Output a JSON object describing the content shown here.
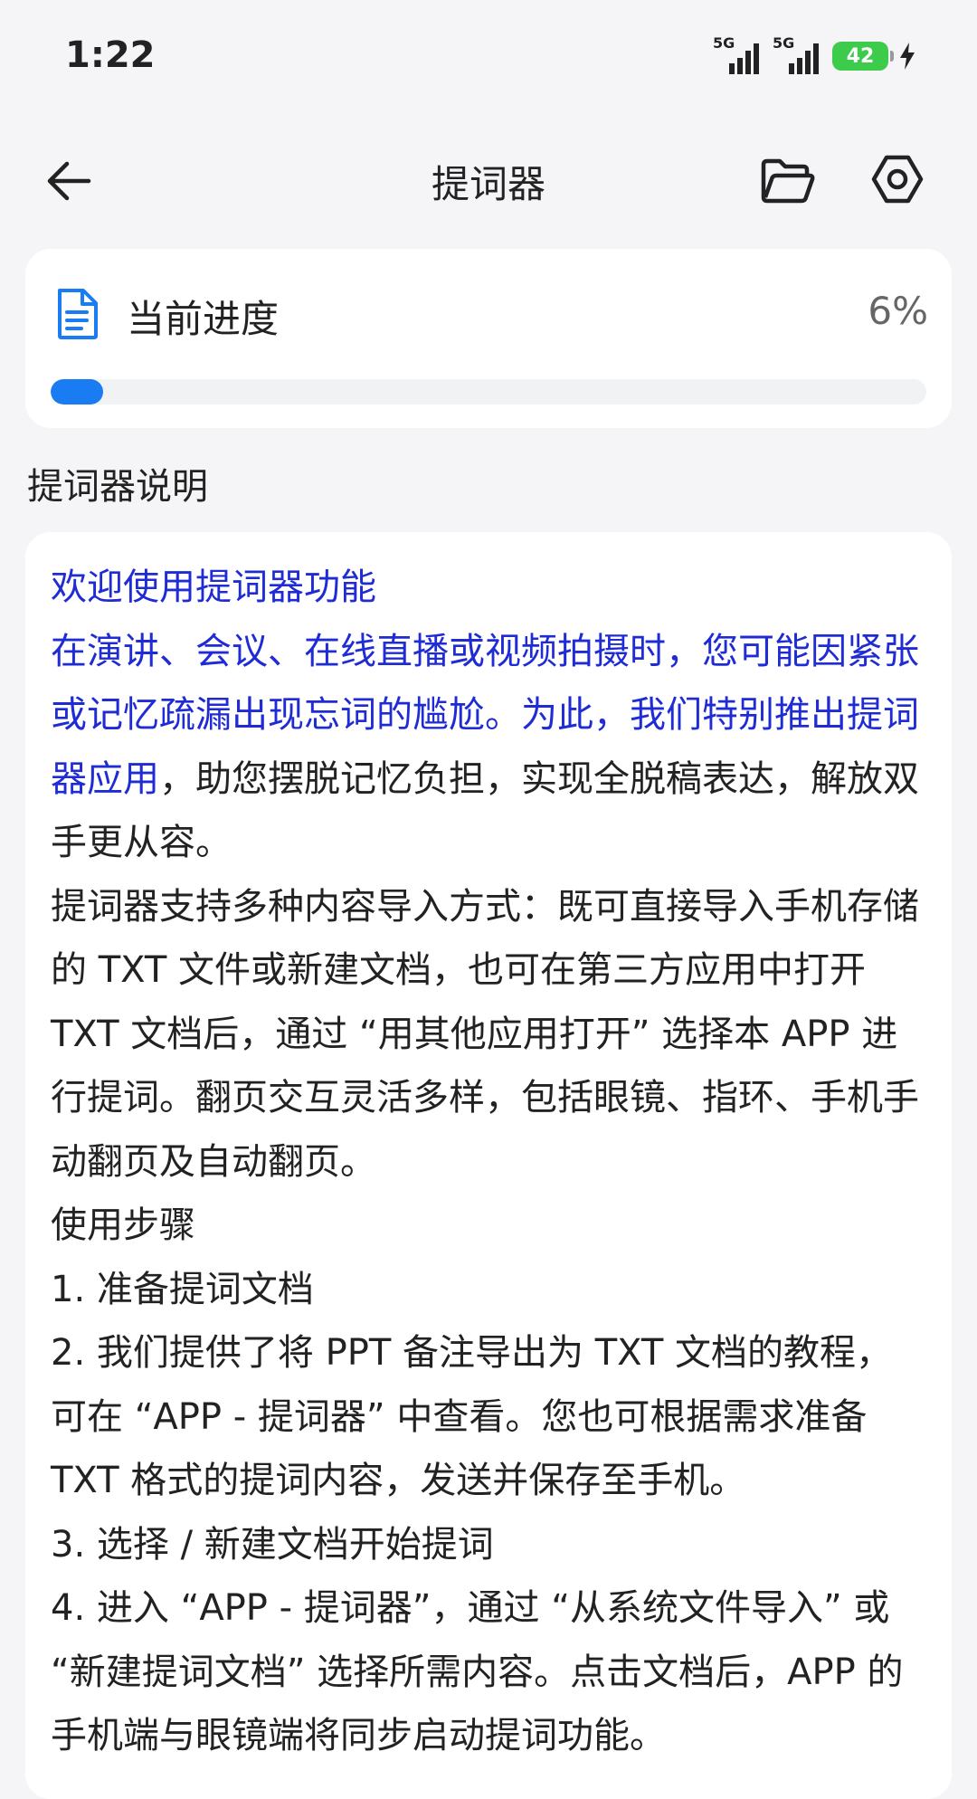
{
  "status_bar": {
    "time": "1:22",
    "network_1": "5G",
    "network_2": "5G",
    "battery": "42"
  },
  "header": {
    "title": "提词器",
    "back_icon": "arrow-left-icon",
    "folder_icon": "folder-icon",
    "settings_icon": "settings-icon"
  },
  "progress": {
    "label": "当前进度",
    "percent_text": "6%",
    "percent_value": 6,
    "icon": "document-icon",
    "bar_color": "#1a7cf2"
  },
  "section_title": "提词器说明",
  "description": {
    "welcome": "欢迎使用提词器功能",
    "intro_highlight": "在演讲、会议、在线直播或视频拍摄时，您可能因紧张或记忆疏漏出现忘词的尴尬。为此，我们特别推出提词器应用",
    "intro_rest": "，助您摆脱记忆负担，实现全脱稿表达，解放双手更从容。",
    "import_info": "提词器支持多种内容导入方式：既可直接导入手机存储的 TXT 文件或新建文档，也可在第三方应用中打开 TXT 文档后，通过 “用其他应用打开” 选择本 APP 进行提词。翻页交互灵活多样，包括眼镜、指环、手机手动翻页及自动翻页。",
    "steps_title": "使用步骤",
    "step_1": "1. 准备提词文档",
    "step_2": "2. 我们提供了将 PPT 备注导出为 TXT 文档的教程，可在 “APP - 提词器” 中查看。您也可根据需求准备 TXT 格式的提词内容，发送并保存至手机。",
    "step_3": "3. 选择 / 新建文档开始提词",
    "step_4": "4. 进入 “APP - 提词器”，通过 “从系统文件导入” 或 “新建提词文档” 选择所需内容。点击文档后，APP 的手机端与眼镜端将同步启动提词功能。"
  },
  "colors": {
    "accent": "#1a7cf2",
    "highlight_text": "#1f2bd4",
    "battery": "#3ccb4a"
  }
}
